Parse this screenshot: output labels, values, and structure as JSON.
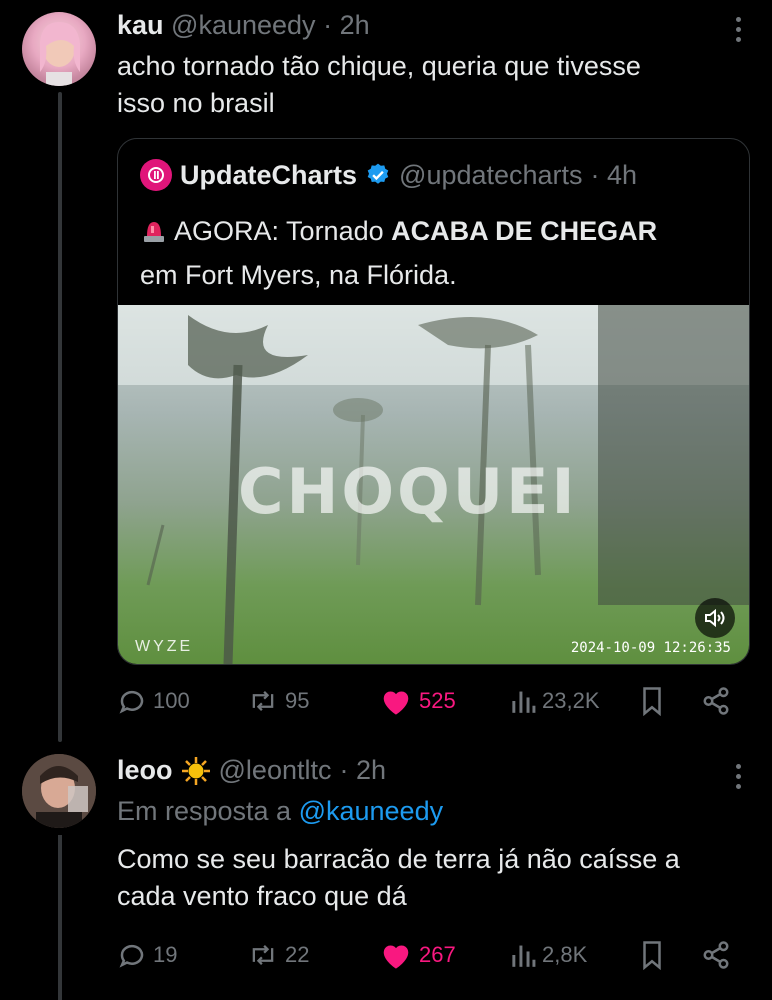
{
  "tweet1": {
    "name": "kau",
    "handle": "@kauneedy",
    "time": "· 2h",
    "text_line1": "acho tornado tão chique, queria que tivesse",
    "text_line2": "isso no brasil",
    "stats": {
      "replies": "100",
      "reposts": "95",
      "likes": "525",
      "views": "23,2K"
    }
  },
  "quote": {
    "name": "UpdateCharts",
    "handle": "@updatecharts",
    "time": "· 4h",
    "text_prefix": "AGORA: Tornado ",
    "text_bold": "ACABA DE CHEGAR",
    "text_line2": "em Fort Myers, na Flórida.",
    "media": {
      "watermark": "CHOQUEI",
      "brand": "WYZE",
      "timestamp": "2024-10-09 12:26:35"
    }
  },
  "tweet2": {
    "name": "leoo",
    "handle": "@leontltc",
    "time": "· 2h",
    "reply_prefix": "Em resposta a ",
    "reply_handle": "@kauneedy",
    "text_line1": "Como se seu barracão de terra já não caísse a",
    "text_line2": "cada vento fraco que dá",
    "stats": {
      "replies": "19",
      "reposts": "22",
      "likes": "267",
      "views": "2,8K"
    }
  },
  "colors": {
    "like": "#f91880",
    "link": "#1d9bf0",
    "verified": "#1d9bf0",
    "muted": "#71767b"
  }
}
